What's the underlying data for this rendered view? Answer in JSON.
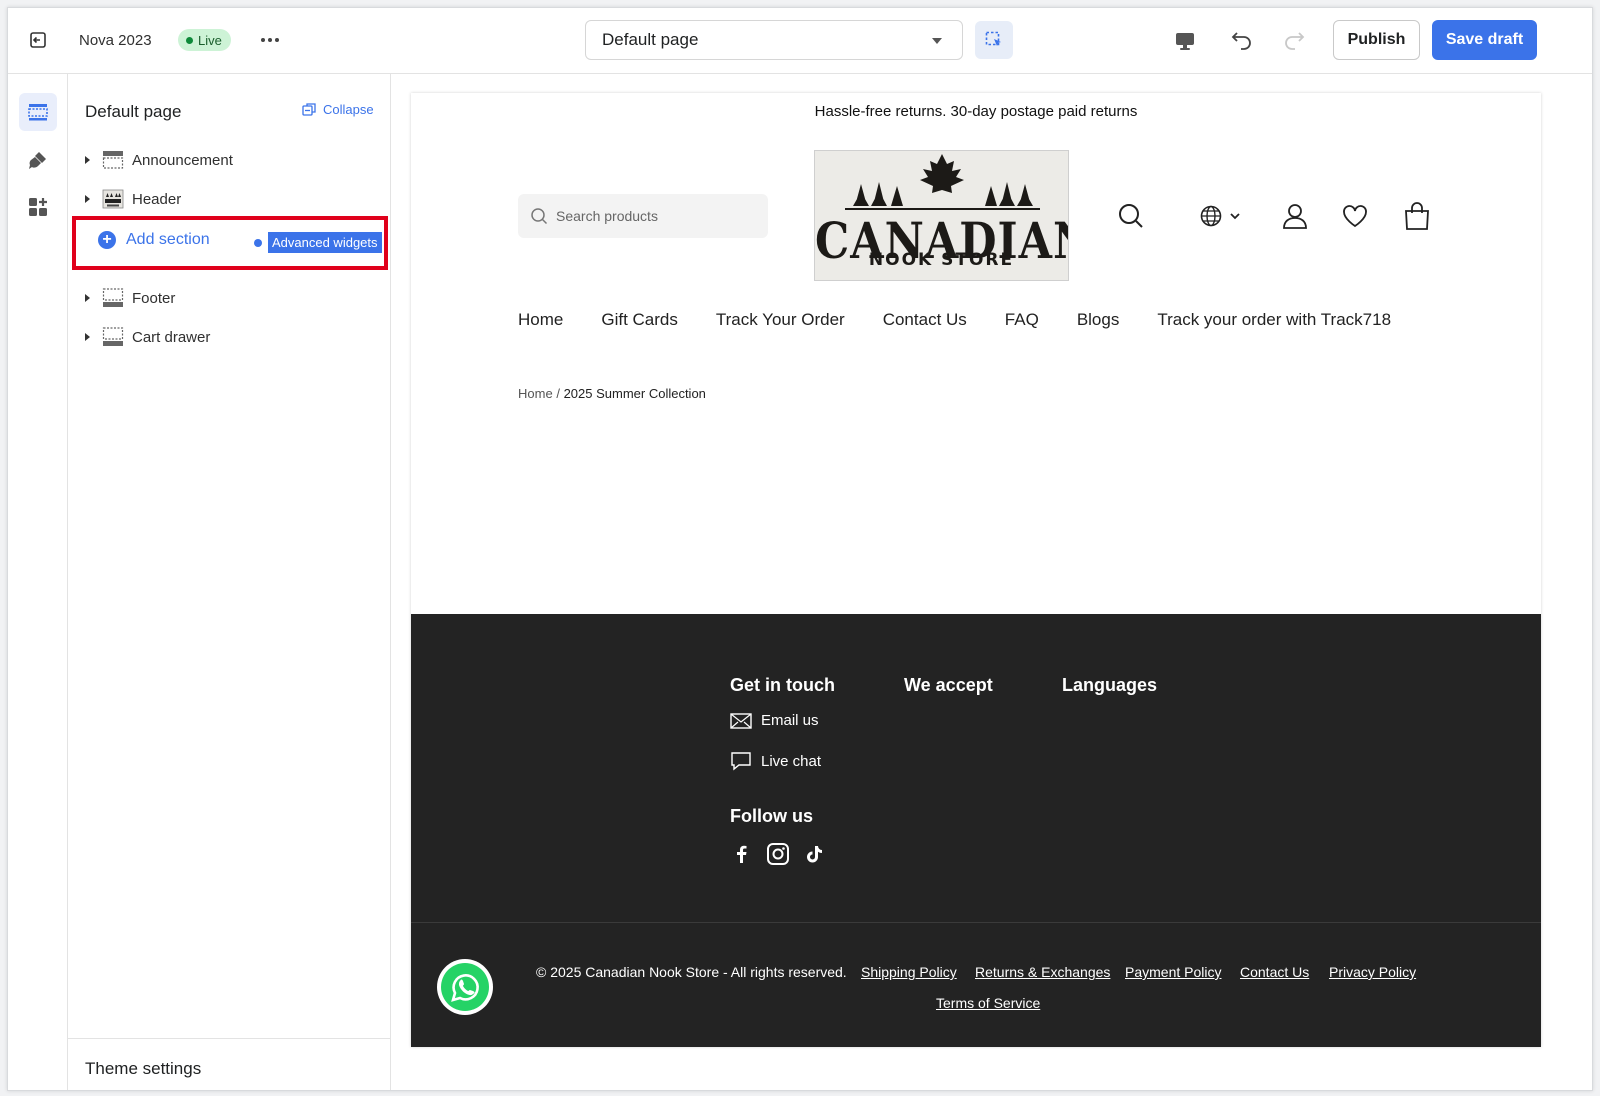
{
  "topbar": {
    "theme_name": "Nova 2023",
    "status": "Live",
    "page_select": "Default page",
    "publish_label": "Publish",
    "save_label": "Save draft"
  },
  "sidebar": {
    "title": "Default page",
    "collapse_label": "Collapse",
    "sections": [
      {
        "label": "Announcement",
        "icon": "section-icon"
      },
      {
        "label": "Header",
        "icon": "header-thumbnail-icon"
      },
      {
        "label": "Footer",
        "icon": "section-icon"
      },
      {
        "label": "Cart drawer",
        "icon": "section-icon"
      }
    ],
    "add_section_label": "Add section",
    "advanced_widgets_label": "Advanced widgets",
    "theme_settings_label": "Theme settings",
    "highlight_color": "#e0001b",
    "accent_color": "#3b73e9"
  },
  "preview": {
    "announcement": "Hassle-free returns. 30-day postage paid returns",
    "search_placeholder": "Search products",
    "logo": {
      "line1": "CANADIAN",
      "line2": "NOOK STORE"
    },
    "nav": [
      "Home",
      "Gift Cards",
      "Track Your Order",
      "Contact Us",
      "FAQ",
      "Blogs",
      "Track your order with Track718"
    ],
    "breadcrumb": {
      "home": "Home",
      "separator": "/",
      "current": "2025 Summer Collection"
    },
    "footer": {
      "get_in_touch": "Get in touch",
      "we_accept": "We accept",
      "languages": "Languages",
      "email_us": "Email us",
      "live_chat": "Live chat",
      "follow_us": "Follow us",
      "copyright": "© 2025 Canadian Nook Store - All rights reserved.",
      "policies": [
        "Shipping Policy",
        "Returns & Exchanges",
        "Payment Policy",
        "Contact Us",
        "Privacy Policy",
        "Terms of Service"
      ]
    }
  }
}
